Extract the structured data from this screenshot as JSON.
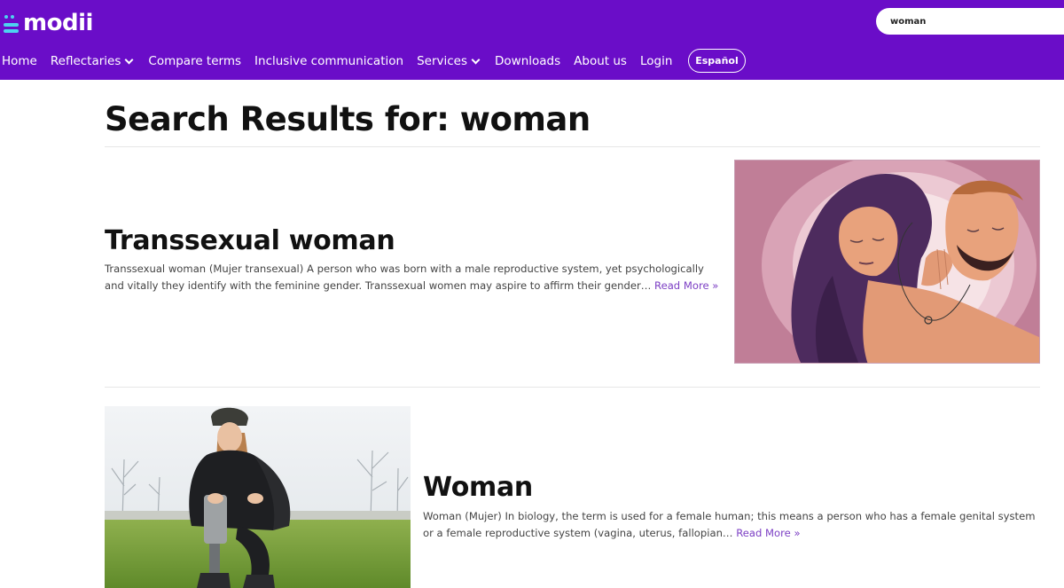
{
  "logo": {
    "text": "modii"
  },
  "search": {
    "value": "woman"
  },
  "nav": {
    "items": [
      {
        "label": "Home"
      },
      {
        "label": "Reflectaries"
      },
      {
        "label": "Compare terms"
      },
      {
        "label": "Inclusive communication"
      },
      {
        "label": "Services"
      },
      {
        "label": "Downloads"
      },
      {
        "label": "About us"
      },
      {
        "label": "Login"
      }
    ],
    "language_button": "Español"
  },
  "page": {
    "title": "Search Results for: woman"
  },
  "results": [
    {
      "title": "Transsexual woman",
      "excerpt": "Transsexual woman (Mujer transexual) A person who was born with a male reproductive system, yet psychologically and vitally they identify with the feminine gender. Transsexual women may aspire to affirm their gender…",
      "read_more": "Read More »"
    },
    {
      "title": "Woman",
      "excerpt": "Woman (Mujer) In biology, the term is used for a female human; this means a person who has a female genital system or a female reproductive system (vagina, uterus, fallopian…",
      "read_more": "Read More »"
    }
  ],
  "colors": {
    "header": "#6a0dc8",
    "accent": "#7c3fc4",
    "logo_mark": "#4dd2f0"
  }
}
